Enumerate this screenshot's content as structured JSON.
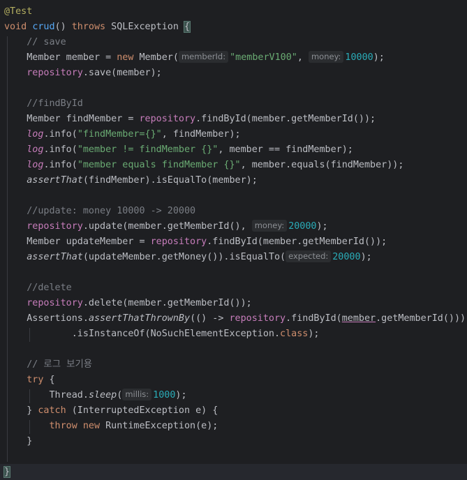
{
  "code": {
    "l1": {
      "annotation": "@Test"
    },
    "l2": {
      "kw_void": "void",
      "method": "crud",
      "parens": "() ",
      "kw_throws": "throws",
      "exc": " SQLException ",
      "brace": "{"
    },
    "l3": {
      "comment": "// save"
    },
    "l4": {
      "p1": "Member member = ",
      "kw_new": "new",
      "p2": " Member(",
      "hint1": "memberId:",
      "str1": "\"memberV100\"",
      "p3": ", ",
      "hint2": "money:",
      "num1": "10000",
      "p4": ");"
    },
    "l5": {
      "field": "repository",
      "p1": ".save(member);"
    },
    "l7": {
      "comment": "//findById"
    },
    "l8": {
      "p1": "Member findMember = ",
      "field": "repository",
      "p2": ".findById(member.getMemberId());"
    },
    "l9": {
      "field": "log",
      "p1": ".info(",
      "str": "\"findMember={}\"",
      "p2": ", findMember);"
    },
    "l10": {
      "field": "log",
      "p1": ".info(",
      "str": "\"member != findMember {}\"",
      "p2": ", member == findMember);"
    },
    "l11": {
      "field": "log",
      "p1": ".info(",
      "str": "\"member equals findMember {}\"",
      "p2": ", member.equals(findMember));"
    },
    "l12": {
      "method": "assertThat",
      "p1": "(findMember).isEqualTo(member);"
    },
    "l14": {
      "comment": "//update: money 10000 -> 20000"
    },
    "l15": {
      "field": "repository",
      "p1": ".update(member.getMemberId(), ",
      "hint": "money:",
      "num": "20000",
      "p2": ");"
    },
    "l16": {
      "p1": "Member updateMember = ",
      "field": "repository",
      "p2": ".findById(member.getMemberId());"
    },
    "l17": {
      "method": "assertThat",
      "p1": "(updateMember.getMoney()).isEqualTo(",
      "hint": "expected:",
      "num": "20000",
      "p2": ");"
    },
    "l19": {
      "comment": "//delete"
    },
    "l20": {
      "field": "repository",
      "p1": ".delete(member.getMemberId());"
    },
    "l21": {
      "p1": "Assertions.",
      "method": "assertThatThrownBy",
      "p2": "(() -> ",
      "field": "repository",
      "p3": ".findById(",
      "member": "member",
      "p4": ".getMemberId()))"
    },
    "l22": {
      "p1": ".isInstanceOf(NoSuchElementException.",
      "kw_class": "class",
      "p2": ");"
    },
    "l24": {
      "comment": "// 로그 보기용"
    },
    "l25": {
      "kw_try": "try",
      "p1": " {"
    },
    "l26": {
      "p1": "Thread.",
      "method": "sleep",
      "p2": "(",
      "hint": "millis:",
      "num": "1000",
      "p3": ");"
    },
    "l27": {
      "p1": "} ",
      "kw_catch": "catch",
      "p2": " (InterruptedException e) {"
    },
    "l28": {
      "kw_throw": "throw",
      "sp": " ",
      "kw_new": "new",
      "p1": " RuntimeException(e);"
    },
    "l29": {
      "p1": "}"
    },
    "l31": {
      "brace": "}"
    }
  }
}
